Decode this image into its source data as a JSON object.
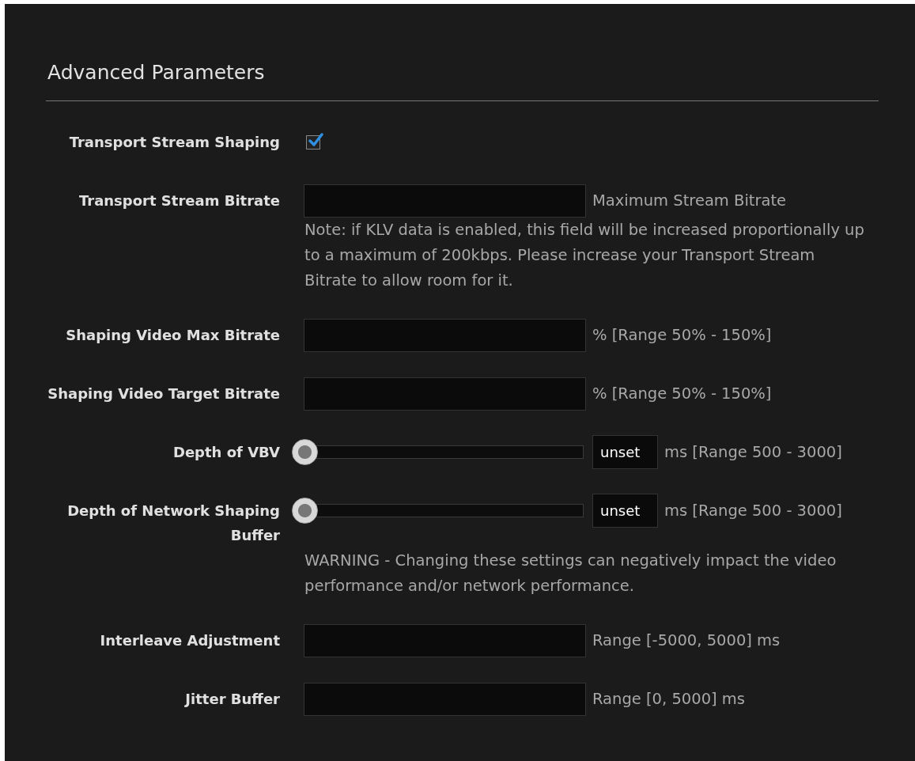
{
  "section": {
    "title": "Advanced Parameters"
  },
  "rows": [
    {
      "kind": "checkbox",
      "label": "Transport Stream Shaping",
      "checked": true
    },
    {
      "kind": "text",
      "label": "Transport Stream Bitrate",
      "hint": "Maximum Stream Bitrate",
      "note": "Note: if KLV data is enabled, this field will be increased proportionally up to a maximum of 200kbps. Please increase your Transport Stream Bitrate to allow room for it."
    },
    {
      "kind": "text",
      "label": "Shaping Video Max Bitrate",
      "hint": "% [Range 50% - 150%]"
    },
    {
      "kind": "text",
      "label": "Shaping Video Target Bitrate",
      "hint": "% [Range 50% - 150%]"
    },
    {
      "kind": "slider",
      "label": "Depth of VBV",
      "level": 0,
      "value": "unset",
      "hint": "ms [Range 500 - 3000]"
    },
    {
      "kind": "slider",
      "label": "Depth of Network Shaping Buffer",
      "level": 0,
      "value": "unset",
      "hint": "ms [Range 500 - 3000]",
      "note": "WARNING - Changing these settings can negatively impact the video performance and/or network performance."
    },
    {
      "kind": "text",
      "label": "Interleave Adjustment",
      "hint": "Range [-5000, 5000] ms"
    },
    {
      "kind": "text",
      "label": "Jitter Buffer",
      "hint": "Range [0, 5000] ms"
    }
  ]
}
